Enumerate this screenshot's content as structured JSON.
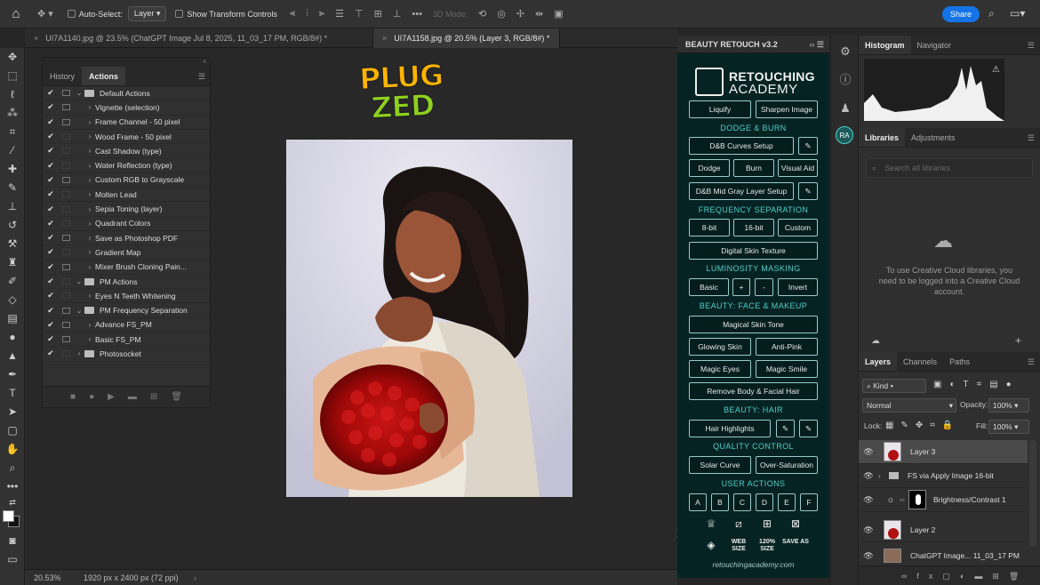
{
  "options_bar": {
    "auto_select_label": "Auto-Select:",
    "auto_select_value": "Layer",
    "transform_controls_label": "Show Transform Controls",
    "mode_label": "3D Mode:",
    "share_label": "Share"
  },
  "doc_tabs": [
    {
      "label": "UI7A1140.jpg @ 23.5% (ChatGPT Image Jul 8, 2025, 11_03_17 PM, RGB/8#) *",
      "active": false
    },
    {
      "label": "UI7A1158.jpg @ 20.5% (Layer 3, RGB/8#) *",
      "active": true
    }
  ],
  "status_bar": {
    "zoom": "20.53%",
    "doc_info": "1920 px x 2400 px (72 ppi)"
  },
  "actions_panel": {
    "tabs": [
      "History",
      "Actions"
    ],
    "rows": [
      {
        "label": "Default Actions",
        "kind": "folder",
        "level": 0,
        "open": true,
        "dialog": true
      },
      {
        "label": "Vignette (selection)",
        "kind": "action",
        "level": 1,
        "dialog": true
      },
      {
        "label": "Frame Channel - 50 pixel",
        "kind": "action",
        "level": 1,
        "dialog": true
      },
      {
        "label": "Wood Frame - 50 pixel",
        "kind": "action",
        "level": 1,
        "dialog": false
      },
      {
        "label": "Cast Shadow (type)",
        "kind": "action",
        "level": 1,
        "dialog": false
      },
      {
        "label": "Water Reflection (type)",
        "kind": "action",
        "level": 1,
        "dialog": false
      },
      {
        "label": "Custom RGB to Grayscale",
        "kind": "action",
        "level": 1,
        "dialog": true
      },
      {
        "label": "Molten Lead",
        "kind": "action",
        "level": 1,
        "dialog": false
      },
      {
        "label": "Sepia Toning (layer)",
        "kind": "action",
        "level": 1,
        "dialog": false
      },
      {
        "label": "Quadrant Colors",
        "kind": "action",
        "level": 1,
        "dialog": false
      },
      {
        "label": "Save as Photoshop PDF",
        "kind": "action",
        "level": 1,
        "dialog": true
      },
      {
        "label": "Gradient Map",
        "kind": "action",
        "level": 1,
        "dialog": false
      },
      {
        "label": "Mixer Brush Cloning Pain...",
        "kind": "action",
        "level": 1,
        "dialog": true
      },
      {
        "label": "PM Actions",
        "kind": "folder",
        "level": 0,
        "open": true,
        "dialog": false
      },
      {
        "label": "Eyes N Teeth Whitening",
        "kind": "action",
        "level": 1,
        "dialog": false
      },
      {
        "label": "PM Frequency Separation",
        "kind": "folder",
        "level": 0,
        "open": true,
        "dialog": true
      },
      {
        "label": "Advance FS_PM",
        "kind": "action",
        "level": 1,
        "dialog": true
      },
      {
        "label": "Basic FS_PM",
        "kind": "action",
        "level": 1,
        "dialog": true
      },
      {
        "label": "Photosocket",
        "kind": "folder",
        "level": 0,
        "open": false,
        "dialog": false
      }
    ]
  },
  "canvas": {
    "logo_line1": "PLUG",
    "logo_line2": "ZED"
  },
  "beauty_panel": {
    "title": "BEAUTY RETOUCH v3.2",
    "logo_line1": "RETOUCHING",
    "logo_line2": "ACADEMY",
    "buttons": {
      "liquify": "Liquify",
      "sharpen": "Sharpen Image",
      "db_curves": "D&B Curves Setup",
      "dodge": "Dodge",
      "burn": "Burn",
      "visual_aid": "Visual Aid",
      "db_midgray": "D&B Mid Gray Layer Setup",
      "bit8": "8-bit",
      "bit16": "16-bit",
      "custom": "Custom",
      "digital_skin": "Digital Skin Texture",
      "basic": "Basic",
      "plus": "+",
      "minus": "-",
      "invert": "Invert",
      "magical_skin": "Magical Skin Tone",
      "glowing_skin": "Glowing Skin",
      "anti_pink": "Anti-Pink",
      "magic_eyes": "Magic Eyes",
      "magic_smile": "Magic Smile",
      "remove_body": "Remove Body & Facial Hair",
      "hair_highlights": "Hair Highlights",
      "solar_curve": "Solar Curve",
      "over_saturation": "Over-Saturation",
      "user_a": "A",
      "user_b": "B",
      "user_c": "C",
      "user_d": "D",
      "user_e": "E",
      "user_f": "F",
      "web_size": "WEB SIZE",
      "size_120": "120% SIZE",
      "save_as": "SAVE AS"
    },
    "sections": {
      "dodge_burn": "DODGE & BURN",
      "freq_sep": "FREQUENCY SEPARATION",
      "lum_mask": "LUMINOSITY MASKING",
      "face_makeup": "BEAUTY: FACE & MAKEUP",
      "hair": "BEAUTY: HAIR",
      "quality": "QUALITY CONTROL",
      "user_actions": "USER ACTIONS"
    },
    "footer": "retouchingacademy.com"
  },
  "icon_column": {
    "badge": "RA"
  },
  "right_panels": {
    "hist_tabs": [
      "Histogram",
      "Navigator"
    ],
    "lib_tabs": [
      "Libraries",
      "Adjustments"
    ],
    "lib_search_placeholder": "Search all libraries",
    "lib_message": "To use Creative Cloud libraries, you need to be logged into a Creative Cloud account.",
    "layer_tabs": [
      "Layers",
      "Channels",
      "Paths"
    ],
    "kind_label": "Kind",
    "blend_mode": "Normal",
    "opacity_label": "Opacity:",
    "opacity_value": "100%",
    "lock_label": "Lock:",
    "fill_label": "Fill:",
    "fill_value": "100%",
    "layers": [
      {
        "name": "Layer 3",
        "selected": true
      },
      {
        "name": "FS via Apply Image 16-bit",
        "selected": false
      },
      {
        "name": "Brightness/Contrast 1",
        "selected": false
      },
      {
        "name": "Layer 2",
        "selected": false
      },
      {
        "name": "ChatGPT Image... 11_03_17 PM",
        "selected": false
      }
    ]
  }
}
